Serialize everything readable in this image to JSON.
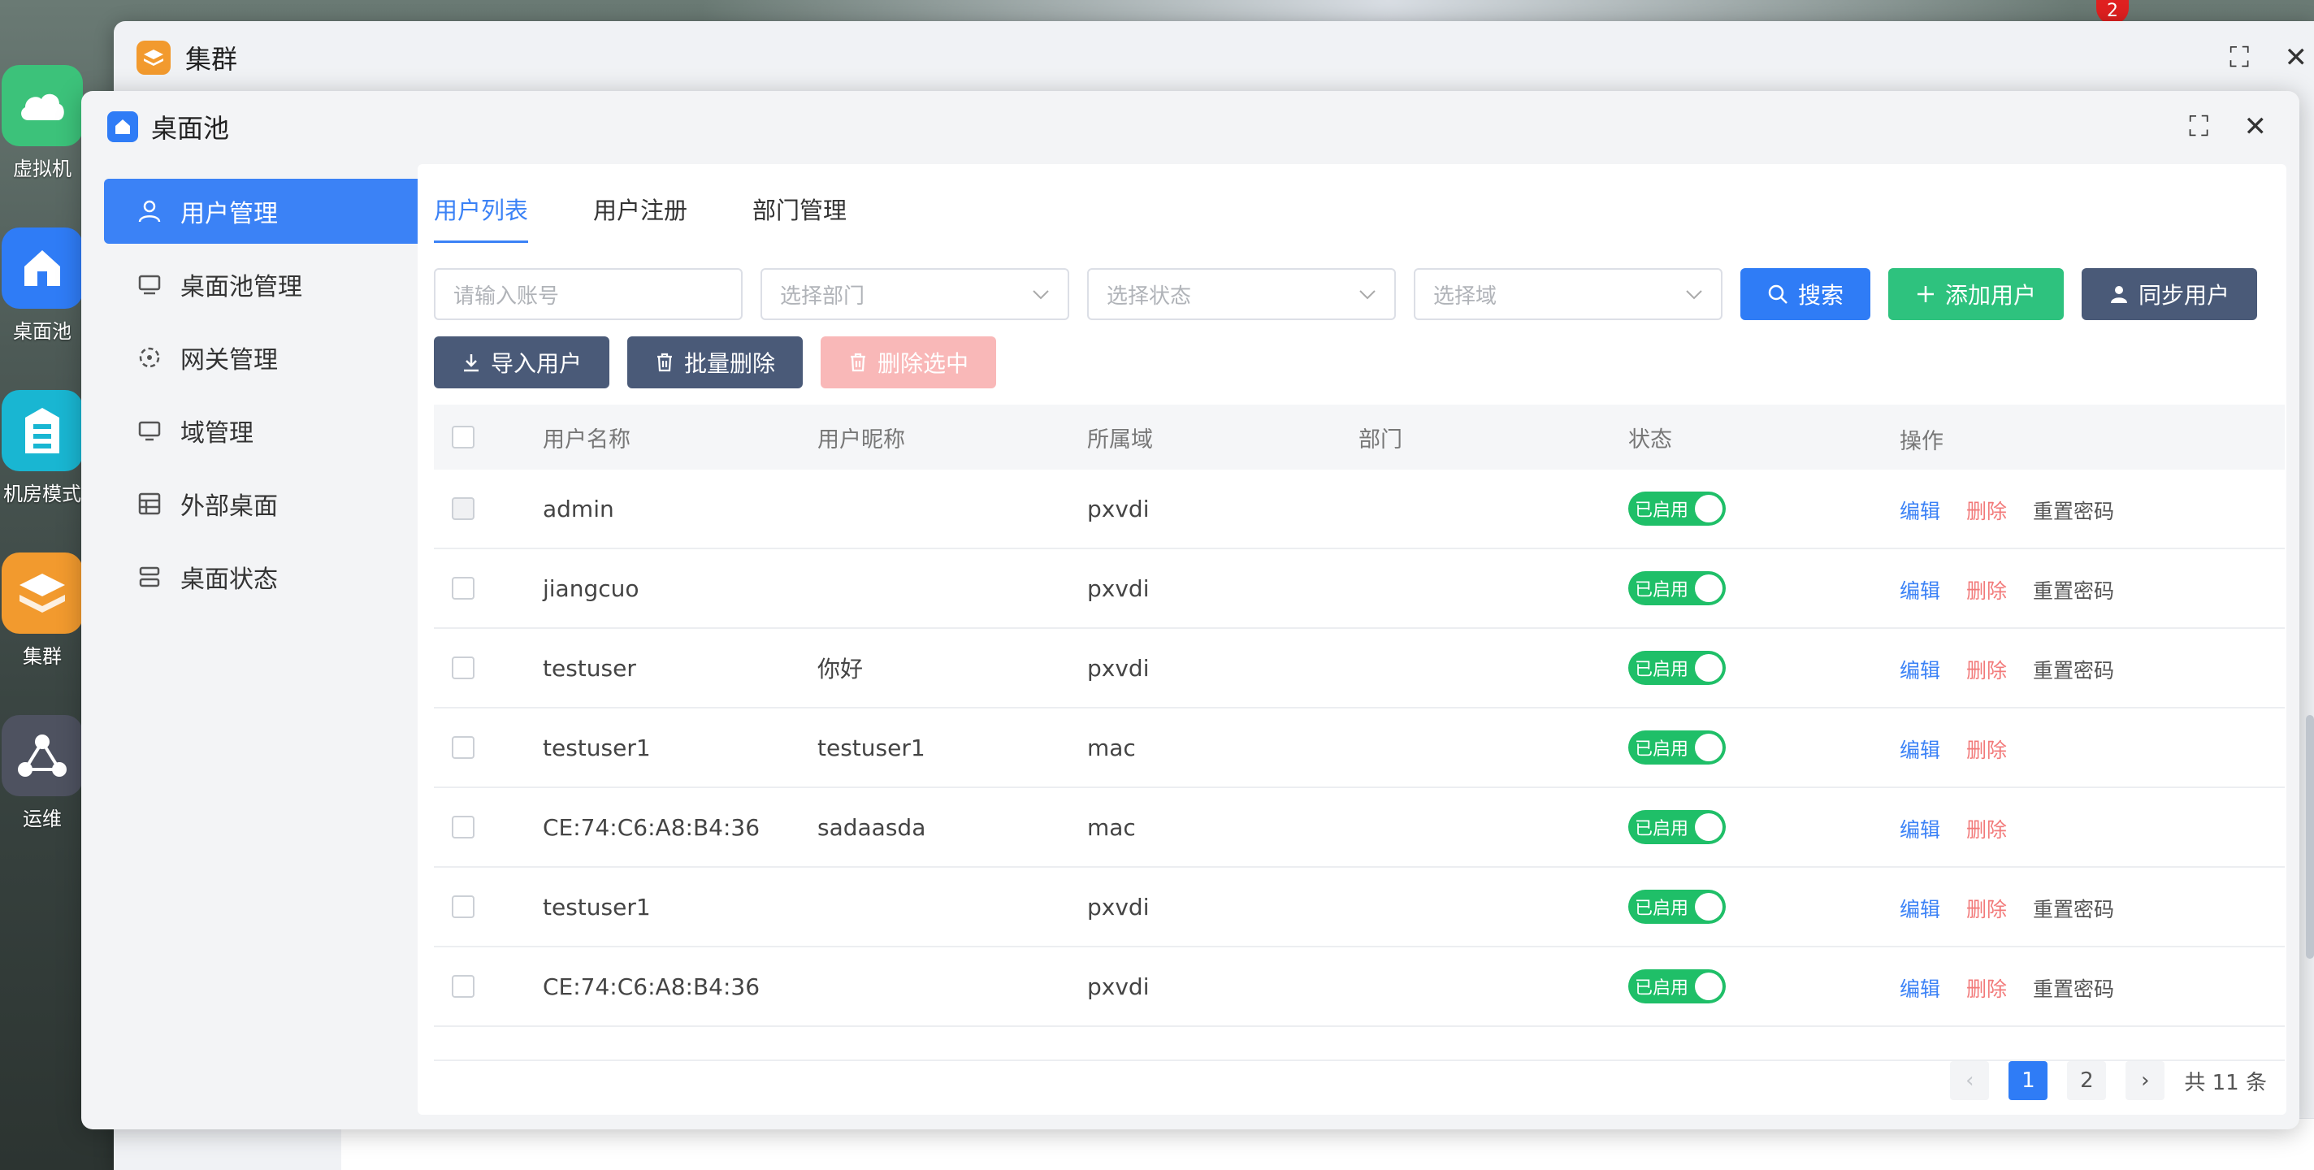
{
  "colors": {
    "primary": "#2f7cf6",
    "success": "#1fbf68",
    "danger": "#f27a7a",
    "slate": "#4a5a78"
  },
  "dock": [
    {
      "label": "虚拟机",
      "icon": "cloud-icon",
      "color": "#3cc27a"
    },
    {
      "label": "桌面池",
      "icon": "home-icon",
      "color": "#2f7cf6"
    },
    {
      "label": "机房模式",
      "icon": "server-icon",
      "color": "#19b6d2"
    },
    {
      "label": "集群",
      "icon": "layers-icon",
      "color": "#f29a2e"
    },
    {
      "label": "运维",
      "icon": "share-icon",
      "color": "#4e5260"
    }
  ],
  "top_badge": "2",
  "back_window": {
    "title": "集群"
  },
  "window": {
    "title": "桌面池"
  },
  "sidebar": {
    "items": [
      {
        "label": "用户管理",
        "icon": "user-icon"
      },
      {
        "label": "桌面池管理",
        "icon": "monitor-icon"
      },
      {
        "label": "网关管理",
        "icon": "gateway-icon"
      },
      {
        "label": "域管理",
        "icon": "domain-icon"
      },
      {
        "label": "外部桌面",
        "icon": "external-desktop-icon"
      },
      {
        "label": "桌面状态",
        "icon": "status-icon"
      }
    ]
  },
  "tabs": [
    "用户列表",
    "用户注册",
    "部门管理"
  ],
  "filters": {
    "account_placeholder": "请输入账号",
    "dept_placeholder": "选择部门",
    "status_placeholder": "选择状态",
    "domain_placeholder": "选择域"
  },
  "buttons": {
    "search": "搜索",
    "add_user": "添加用户",
    "sync_user": "同步用户",
    "import_user": "导入用户",
    "batch_delete": "批量删除",
    "delete_selected": "删除选中"
  },
  "table": {
    "headers": [
      "用户名称",
      "用户昵称",
      "所属域",
      "部门",
      "状态",
      "操作"
    ],
    "rows": [
      {
        "name": "admin",
        "nick": "",
        "domain": "pxvdi",
        "dept": "",
        "status": "已启用",
        "reset": true
      },
      {
        "name": "jiangcuo",
        "nick": "",
        "domain": "pxvdi",
        "dept": "",
        "status": "已启用",
        "reset": true
      },
      {
        "name": "testuser",
        "nick": "你好",
        "domain": "pxvdi",
        "dept": "",
        "status": "已启用",
        "reset": true
      },
      {
        "name": "testuser1",
        "nick": "testuser1",
        "domain": "mac",
        "dept": "",
        "status": "已启用",
        "reset": false
      },
      {
        "name": "CE:74:C6:A8:B4:36",
        "nick": "sadaasda",
        "domain": "mac",
        "dept": "",
        "status": "已启用",
        "reset": false
      },
      {
        "name": "testuser1",
        "nick": "",
        "domain": "pxvdi",
        "dept": "",
        "status": "已启用",
        "reset": true
      },
      {
        "name": "CE:74:C6:A8:B4:36",
        "nick": "",
        "domain": "pxvdi",
        "dept": "",
        "status": "已启用",
        "reset": true
      }
    ],
    "actions": {
      "edit": "编辑",
      "delete": "删除",
      "reset": "重置密码"
    }
  },
  "pagination": {
    "pages": [
      "1",
      "2"
    ],
    "current": "1",
    "total": "共 11 条",
    "prev": "‹",
    "next": "›"
  }
}
